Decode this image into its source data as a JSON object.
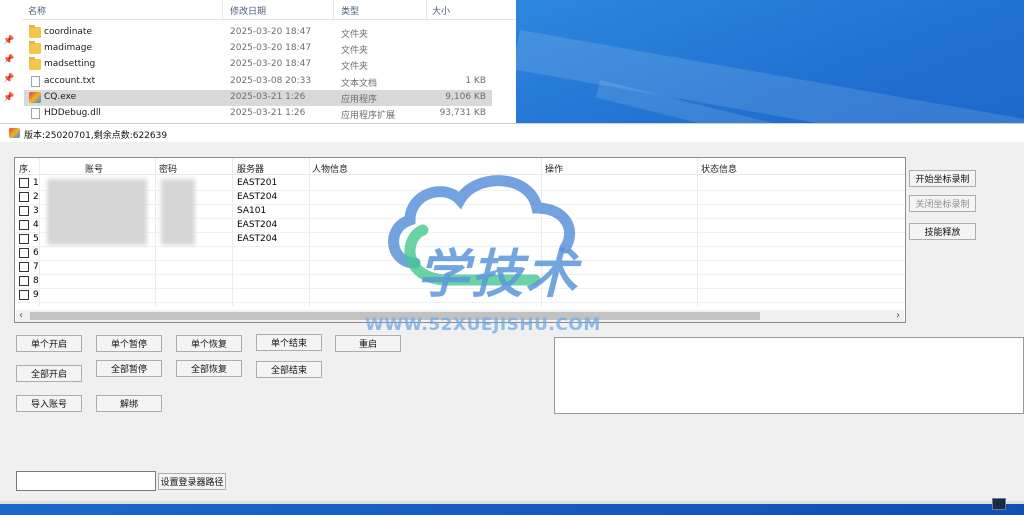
{
  "explorer": {
    "headers": {
      "name": "名称",
      "date": "修改日期",
      "type": "类型",
      "size": "大小"
    },
    "files": [
      {
        "name": "coordinate",
        "date": "2025-03-20 18:47",
        "type": "文件夹",
        "size": "",
        "icon": "folder-icon"
      },
      {
        "name": "madimage",
        "date": "2025-03-20 18:47",
        "type": "文件夹",
        "size": "",
        "icon": "folder-icon"
      },
      {
        "name": "madsetting",
        "date": "2025-03-20 18:47",
        "type": "文件夹",
        "size": "",
        "icon": "folder-icon"
      },
      {
        "name": "account.txt",
        "date": "2025-03-08 20:33",
        "type": "文本文档",
        "size": "1 KB",
        "icon": "text-file-icon"
      },
      {
        "name": "CQ.exe",
        "date": "2025-03-21 1:26",
        "type": "应用程序",
        "size": "9,106 KB",
        "icon": "exe-icon",
        "selected": true
      },
      {
        "name": "HDDebug.dll",
        "date": "2025-03-21 1:26",
        "type": "应用程序扩展",
        "size": "93,731 KB",
        "icon": "dll-file-icon"
      }
    ]
  },
  "app": {
    "title": "版本:25020701,剩余点数:622639",
    "columns": {
      "index": "序.",
      "account": "账号",
      "password": "密码",
      "server": "服务器",
      "character": "人物信息",
      "action": "操作",
      "status": "状态信息"
    },
    "rows": [
      {
        "num": "1",
        "server": "EAST201"
      },
      {
        "num": "2",
        "server": "EAST204"
      },
      {
        "num": "3",
        "server": "SA101"
      },
      {
        "num": "4",
        "server": "EAST204"
      },
      {
        "num": "5",
        "server": "EAST204"
      },
      {
        "num": "6",
        "server": ""
      },
      {
        "num": "7",
        "server": ""
      },
      {
        "num": "8",
        "server": ""
      },
      {
        "num": "9",
        "server": ""
      }
    ],
    "buttons": {
      "single_start": "单个开启",
      "single_pause": "单个暂停",
      "single_resume": "单个恢复",
      "single_end": "单个结束",
      "restart": "重启",
      "all_start": "全部开启",
      "all_pause": "全部暂停",
      "all_resume": "全部恢复",
      "all_end": "全部结束",
      "import_account": "导入账号",
      "unbind": "解绑",
      "start_coord_record": "开始坐标录制",
      "stop_coord_record": "关闭坐标录制",
      "skill_release": "技能释放",
      "set_login_path": "设置登录器路径"
    },
    "path_input_value": ""
  },
  "watermark": {
    "text": "学技术",
    "url": "WWW.52XUEJISHU.COM"
  }
}
